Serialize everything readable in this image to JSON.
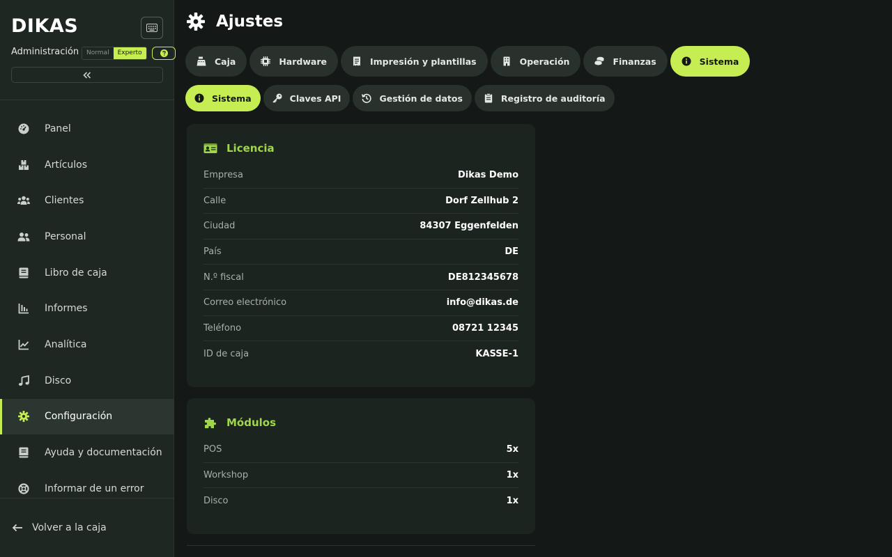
{
  "sidebar": {
    "logo": "DIKAS",
    "admin_label": "Administración",
    "mode_normal": "Normal",
    "mode_expert": "Experto",
    "collapse_label": "«",
    "items": [
      {
        "label": "Panel",
        "icon": "gauge-icon"
      },
      {
        "label": "Artículos",
        "icon": "boxes-icon"
      },
      {
        "label": "Clientes",
        "icon": "users-icon"
      },
      {
        "label": "Personal",
        "icon": "staff-icon"
      },
      {
        "label": "Libro de caja",
        "icon": "book-icon"
      },
      {
        "label": "Informes",
        "icon": "bar-chart-icon"
      },
      {
        "label": "Analítica",
        "icon": "line-chart-icon"
      },
      {
        "label": "Disco",
        "icon": "music-icon"
      },
      {
        "label": "Configuración",
        "icon": "gear-icon",
        "active": true
      },
      {
        "label": "Ayuda y documentación",
        "icon": "docs-icon"
      },
      {
        "label": "Informar de un error",
        "icon": "lifebuoy-icon"
      }
    ],
    "back_label": "Volver a la caja"
  },
  "header": {
    "title": "Ajustes"
  },
  "tabs": [
    {
      "label": "Caja",
      "icon": "cash-register-icon"
    },
    {
      "label": "Hardware",
      "icon": "chip-icon"
    },
    {
      "label": "Impresión y plantillas",
      "icon": "receipt-icon"
    },
    {
      "label": "Operación",
      "icon": "building-icon"
    },
    {
      "label": "Finanzas",
      "icon": "coins-icon"
    },
    {
      "label": "Sistema",
      "icon": "info-icon",
      "active": true
    }
  ],
  "subtabs": [
    {
      "label": "Sistema",
      "icon": "info-icon",
      "active": true
    },
    {
      "label": "Claves API",
      "icon": "key-icon"
    },
    {
      "label": "Gestión de datos",
      "icon": "history-icon"
    },
    {
      "label": "Registro de auditoría",
      "icon": "clipboard-icon"
    }
  ],
  "license": {
    "title": "Licencia",
    "rows": [
      {
        "label": "Empresa",
        "value": "Dikas Demo"
      },
      {
        "label": "Calle",
        "value": "Dorf Zellhub 2"
      },
      {
        "label": "Ciudad",
        "value": "84307 Eggenfelden"
      },
      {
        "label": "País",
        "value": "DE"
      },
      {
        "label": "N.º fiscal",
        "value": "DE812345678"
      },
      {
        "label": "Correo electrónico",
        "value": "info@dikas.de"
      },
      {
        "label": "Teléfono",
        "value": "08721 12345"
      },
      {
        "label": "ID de caja",
        "value": "KASSE-1"
      }
    ]
  },
  "modules": {
    "title": "Módulos",
    "rows": [
      {
        "label": "POS",
        "value": "5x"
      },
      {
        "label": "Workshop",
        "value": "1x"
      },
      {
        "label": "Disco",
        "value": "1x"
      }
    ]
  },
  "colors": {
    "accent": "#c6ee52",
    "card_title": "#9fd64a",
    "background": "#141816",
    "sidebar": "#1f2723"
  }
}
